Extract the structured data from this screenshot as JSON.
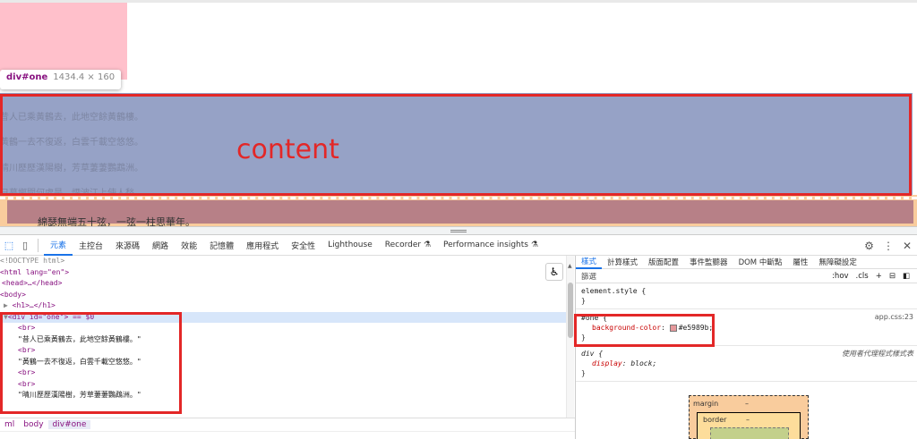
{
  "viewport": {
    "tooltip": {
      "tag": "div#one",
      "size": "1434.4 × 160"
    },
    "poem_lines": [
      "昔人已乘黃鶴去，此地空餘黃鶴樓。",
      "黃鶴一去不復返，白雲千載空悠悠。",
      "晴川歷歷漢陽樹，芳草萋萋鸚鵡洲。",
      "日暮鄉關何處是，煙波江上使人愁。"
    ],
    "next_line": "綿瑟無端五十弦，一弦一柱思華年。",
    "annotation": "content"
  },
  "devtools": {
    "tabs": [
      "元素",
      "主控台",
      "來源碼",
      "網路",
      "效能",
      "記憶體",
      "應用程式",
      "安全性",
      "Lighthouse",
      "Recorder",
      "Performance insights"
    ],
    "active_tab": "元素",
    "elements_lines": [
      "<!DOCTYPE html>",
      "<html lang=\"en\">",
      "<head>…</head>",
      "<body>",
      "<h1>…</h1>",
      "<div id=\"one\"> == $0",
      "<br>",
      "\"昔人已乘黃鶴去，此地空餘黃鶴樓。\"",
      "<br>",
      "\"黃鶴一去不復返，白雲千載空悠悠。\"",
      "<br>",
      "<br>",
      "\"晴川歷歷漢陽樹，芳草萋萋鸚鵡洲。\""
    ],
    "breadcrumbs": [
      "ml",
      "body",
      "div#one"
    ],
    "styles": {
      "tabs": [
        "樣式",
        "計算樣式",
        "版面配置",
        "事件監聽器",
        "DOM 中斷點",
        "屬性",
        "無障礙設定"
      ],
      "filter_placeholder": "篩選",
      "filter_buttons": [
        ":hov",
        ".cls",
        "+"
      ],
      "element_style": "element.style {",
      "rule1_selector": "#one {",
      "rule1_property": "background-color",
      "rule1_value": "#e5989b;",
      "rule1_source": "app.css:23",
      "rule2_selector": "div {",
      "rule2_property": "display",
      "rule2_value": "block;",
      "rule2_source": "使用者代理程式樣式表",
      "close_brace": "}",
      "boxmodel": {
        "margin": "margin",
        "margin_val": "–",
        "border": "border",
        "border_val": "–"
      }
    },
    "swatch_color": "#e5989b"
  }
}
